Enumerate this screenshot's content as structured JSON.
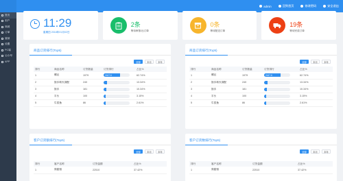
{
  "topbar": {
    "user": "admin",
    "items": [
      {
        "label": "回到首页",
        "icon": "home-icon"
      },
      {
        "label": "修改密码",
        "icon": "lock-icon"
      },
      {
        "label": "安全退出",
        "icon": "power-icon"
      }
    ]
  },
  "sidebar": {
    "items": [
      {
        "label": "首页"
      },
      {
        "label": "用户"
      },
      {
        "label": "商城"
      },
      {
        "label": "订单"
      },
      {
        "label": "营销"
      },
      {
        "label": "设置"
      },
      {
        "label": "PC端"
      },
      {
        "label": "公众号"
      },
      {
        "label": "APP"
      }
    ]
  },
  "stats": {
    "clock": {
      "time": "11:29",
      "date": "星期四 2018年01月02日"
    },
    "pending_pay": {
      "value": "2条",
      "label": "等待审核/出订单",
      "color": "#19be6b"
    },
    "pending_ship": {
      "value": "0条",
      "label": "等待配送订单",
      "color": "#f7b52c"
    },
    "done": {
      "value": "19条",
      "label": "等待完成订单",
      "color": "#ed4014"
    }
  },
  "colors": {
    "accent": "#2f8ff0"
  },
  "panels": {
    "goods_top": {
      "title": "商品订货排行(Top5)",
      "btn_all": "全部",
      "btn_month": "本月",
      "btn_year": "本年",
      "headers": {
        "rank": "排行",
        "name": "商品名称",
        "count": "订货数量",
        "chart": "订货排行",
        "pct": "占比%"
      },
      "rows": [
        {
          "rank": "1",
          "name": "螺丝",
          "count": "1979",
          "pct": "62.74%",
          "bar": 0.6274,
          "bar_label": "2447.6"
        },
        {
          "rank": "2",
          "name": "扳手和天湖配",
          "count": "240",
          "pct": "13.34%",
          "bar": 0.1334,
          "bar_label": ""
        },
        {
          "rank": "3",
          "name": "扳手",
          "count": "181",
          "pct": "10.34%",
          "bar": 0.1034,
          "bar_label": ""
        },
        {
          "rank": "4",
          "name": "平头",
          "count": "100",
          "pct": "3.15%",
          "bar": 0.0315,
          "bar_label": ""
        },
        {
          "rank": "5",
          "name": "牛类鱼",
          "count": "86",
          "pct": "2.61%",
          "bar": 0.0261,
          "bar_label": ""
        }
      ]
    },
    "goods_top_right": {
      "title": "商品订货排行(Top5)",
      "btn_all": "全部",
      "btn_month": "本月",
      "btn_year": "本年",
      "headers": {
        "rank": "排行",
        "name": "商品名称",
        "count": "订货数量",
        "chart": "订货排行",
        "pct": "占比%"
      },
      "rows": [
        {
          "rank": "1",
          "name": "螺丝",
          "count": "1979",
          "pct": "62.74%",
          "bar": 0.6274,
          "bar_label": "2447.6"
        },
        {
          "rank": "2",
          "name": "扳手和天湖配",
          "count": "240",
          "pct": "13.34%",
          "bar": 0.1334,
          "bar_label": ""
        },
        {
          "rank": "3",
          "name": "扳手",
          "count": "181",
          "pct": "10.34%",
          "bar": 0.1034,
          "bar_label": ""
        },
        {
          "rank": "4",
          "name": "平头",
          "count": "100",
          "pct": "3.15%",
          "bar": 0.0315,
          "bar_label": ""
        },
        {
          "rank": "5",
          "name": "牛类鱼",
          "count": "86",
          "pct": "2.61%",
          "bar": 0.0261,
          "bar_label": ""
        }
      ]
    },
    "customer_amount": {
      "title": "客户订货额排行(Top5)",
      "btn_all": "全部",
      "btn_month": "本月",
      "btn_year": "本年",
      "headers": {
        "rank": "排行",
        "name": "客户名称",
        "amount": "订货金额",
        "pct": "占比%"
      },
      "rows": [
        {
          "rank": "1",
          "name": "周星驰",
          "amount": "22510",
          "pct": "37.42%"
        }
      ]
    },
    "customer_count": {
      "title": "客户订货数排行(Top5)",
      "btn_all": "全部",
      "btn_month": "本月",
      "btn_year": "本年",
      "headers": {
        "rank": "排行",
        "name": "客户名称",
        "amount": "订货金额",
        "pct": "占比%"
      },
      "rows": [
        {
          "rank": "1",
          "name": "周星驰",
          "amount": "22510",
          "pct": "37.42%"
        }
      ]
    }
  }
}
